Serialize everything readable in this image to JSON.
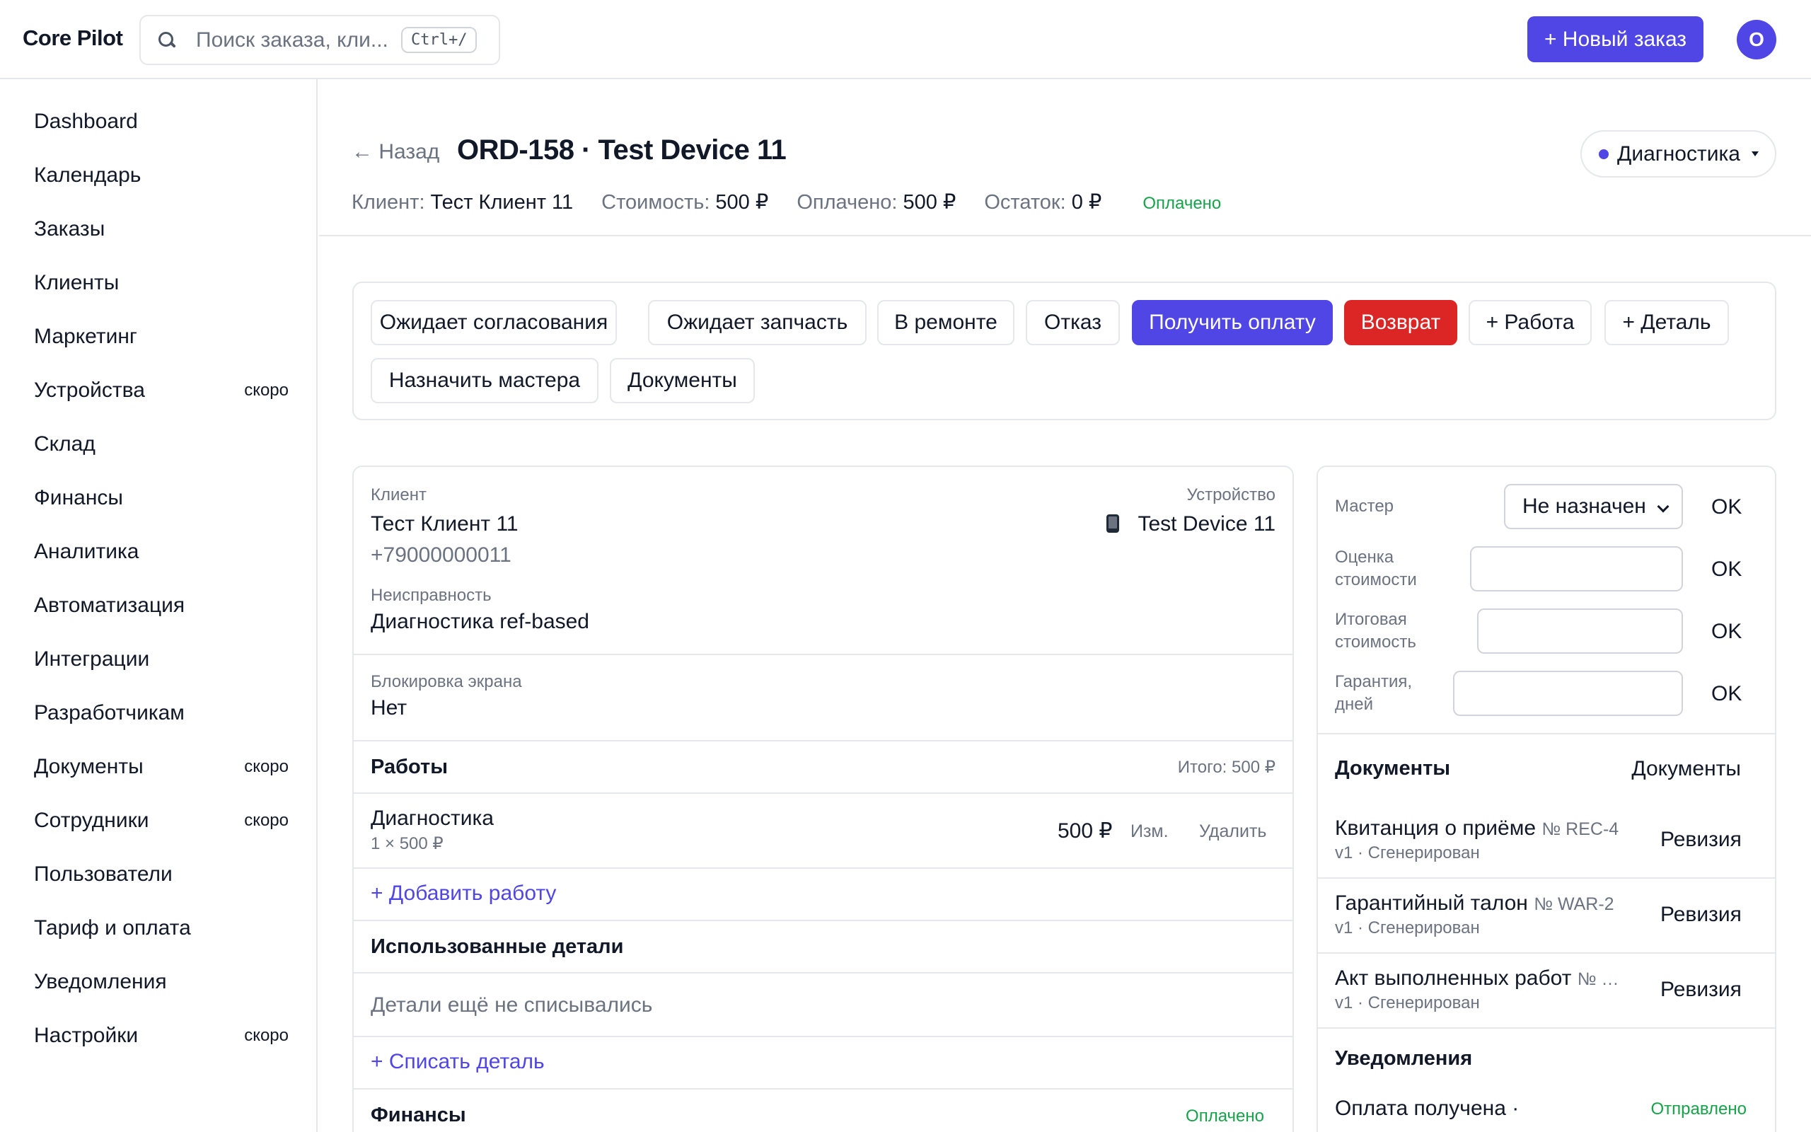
{
  "topbar": {
    "brand": "Core Pilot",
    "search_placeholder": "Поиск заказа, кли...",
    "search_shortcut": "Ctrl+/",
    "new_order": "+ Новый заказ",
    "avatar_initial": "O"
  },
  "sidebar": {
    "items": [
      {
        "label": "Dashboard",
        "badge": ""
      },
      {
        "label": "Календарь",
        "badge": ""
      },
      {
        "label": "Заказы",
        "badge": ""
      },
      {
        "label": "Клиенты",
        "badge": ""
      },
      {
        "label": "Маркетинг",
        "badge": ""
      },
      {
        "label": "Устройства",
        "badge": "скоро"
      },
      {
        "label": "Склад",
        "badge": ""
      },
      {
        "label": "Финансы",
        "badge": ""
      },
      {
        "label": "Аналитика",
        "badge": ""
      },
      {
        "label": "Автоматизация",
        "badge": ""
      },
      {
        "label": "Интеграции",
        "badge": ""
      },
      {
        "label": "Разработчикам",
        "badge": ""
      },
      {
        "label": "Документы",
        "badge": "скоро"
      },
      {
        "label": "Сотрудники",
        "badge": "скоро"
      },
      {
        "label": "Пользователи",
        "badge": ""
      },
      {
        "label": "Тариф и оплата",
        "badge": ""
      },
      {
        "label": "Уведомления",
        "badge": ""
      },
      {
        "label": "Настройки",
        "badge": "скоро"
      }
    ]
  },
  "header": {
    "back": "← Назад",
    "title": "ORD-158 · Test Device 11",
    "status": "Диагностика",
    "client_label": "Клиент:",
    "client_value": "Тест Клиент 11",
    "cost_label": "Стоимость:",
    "cost_value": "500 ₽",
    "paid_label": "Оплачено:",
    "paid_value": "500 ₽",
    "rest_label": "Остаток:",
    "rest_value": "0 ₽",
    "payment_status": "Оплачено"
  },
  "actions": {
    "awaiting_approval": "Ожидает согласования",
    "awaiting_part": "Ожидает запчасть",
    "in_repair": "В ремонте",
    "refuse": "Отказ",
    "get_payment": "Получить оплату",
    "refund": "Возврат",
    "add_work": "+ Работа",
    "add_part": "+ Деталь",
    "assign_master": "Назначить мастера",
    "documents": "Документы"
  },
  "main": {
    "client_caption": "Клиент",
    "client_name": "Тест Клиент 11",
    "client_phone": "+79000000011",
    "device_caption": "Устройство",
    "device_name": "Test Device 11",
    "fault_caption": "Неисправность",
    "fault_value": "Диагностика ref-based",
    "lock_caption": "Блокировка экрана",
    "lock_value": "Нет",
    "works_title": "Работы",
    "works_total": "Итого: 500 ₽",
    "work_name": "Диагностика",
    "work_qty": "1 × 500 ₽",
    "work_price": "500 ₽",
    "work_edit": "Изм.",
    "work_delete": "Удалить",
    "add_work_link": "+ Добавить работу",
    "parts_title": "Использованные детали",
    "parts_empty": "Детали ещё не списывались",
    "write_off_link": "+ Списать деталь",
    "finance_title": "Финансы",
    "finance_status": "Оплачено"
  },
  "side": {
    "master_label": "Мастер",
    "master_value": "Не назначен",
    "estimate_label": "Оценка стоимости",
    "final_label": "Итоговая стоимость",
    "warranty_label": "Гарантия, дней",
    "ok": "OK",
    "docs_title": "Документы",
    "docs_link": "Документы",
    "docs": [
      {
        "title": "Квитанция о приёме",
        "num": "№ REC-4",
        "meta": "v1 · Сгенерирован",
        "action": "Ревизия"
      },
      {
        "title": "Гарантийный талон",
        "num": "№ WAR-2",
        "meta": "v1 · Сгенерирован",
        "action": "Ревизия"
      },
      {
        "title": "Акт выполненных работ",
        "num": "№ …",
        "meta": "v1 · Сгенерирован",
        "action": "Ревизия"
      }
    ],
    "notif_title": "Уведомления",
    "notif_item": "Оплата получена ·",
    "notif_status": "Отправлено"
  }
}
